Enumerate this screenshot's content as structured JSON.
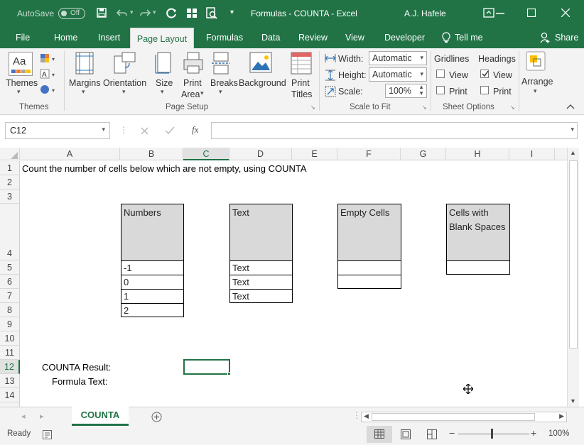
{
  "window": {
    "autosave_label": "AutoSave",
    "autosave_state": "Off",
    "title": "Formulas - COUNTA  -  Excel",
    "user": "A.J. Hafele"
  },
  "tabs": [
    "File",
    "Home",
    "Insert",
    "Page Layout",
    "Formulas",
    "Data",
    "Review",
    "View",
    "Developer"
  ],
  "tell_me": "Tell me",
  "share": "Share",
  "ribbon": {
    "themes": {
      "label": "Themes",
      "group": "Themes"
    },
    "page_setup": {
      "group": "Page Setup",
      "margins": "Margins",
      "orientation": "Orientation",
      "size": "Size",
      "print_area": [
        "Print",
        "Area"
      ],
      "breaks": "Breaks",
      "background": "Background",
      "print_titles": [
        "Print",
        "Titles"
      ]
    },
    "scale_to_fit": {
      "group": "Scale to Fit",
      "width_label": "Width:",
      "width_value": "Automatic",
      "height_label": "Height:",
      "height_value": "Automatic",
      "scale_label": "Scale:",
      "scale_value": "100%"
    },
    "sheet_options": {
      "group": "Sheet Options",
      "gridlines": "Gridlines",
      "headings": "Headings",
      "view": "View",
      "print": "Print",
      "headings_view_checked": true
    },
    "arrange": {
      "label": "Arrange"
    }
  },
  "formula_bar": {
    "name_box": "C12",
    "formula": ""
  },
  "columns": [
    "A",
    "B",
    "C",
    "D",
    "E",
    "F",
    "G",
    "H",
    "I"
  ],
  "rows": [
    "1",
    "2",
    "3",
    "4",
    "5",
    "6",
    "7",
    "8",
    "9",
    "10",
    "11",
    "12",
    "13",
    "14"
  ],
  "sheet": {
    "a1": "Count the number of cells below which are not empty, using COUNTA",
    "numbers_header": "Numbers",
    "numbers": [
      "-1",
      "0",
      "1",
      "2"
    ],
    "text_header": "Text",
    "text": [
      "Text",
      "Text",
      "Text"
    ],
    "empty_header": "Empty Cells",
    "blank_header_line1": "Cells with",
    "blank_header_line2": "Blank Spaces",
    "result_label": "COUNTA Result:",
    "formula_label": "Formula Text:"
  },
  "sheet_tab": "COUNTA",
  "status": {
    "ready": "Ready",
    "zoom": "100%"
  }
}
